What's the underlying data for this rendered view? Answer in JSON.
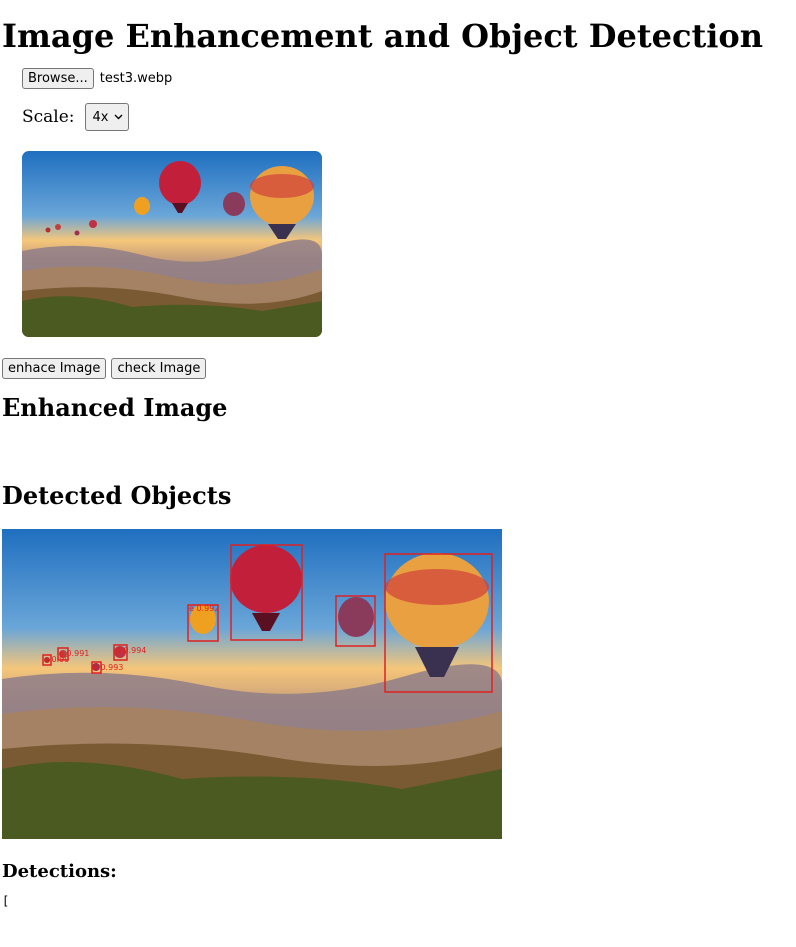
{
  "page": {
    "title": "Image Enhancement and Object Detection"
  },
  "upload": {
    "browse_label": "Browse...",
    "filename": "test3.webp"
  },
  "scale": {
    "label": "Scale:",
    "selected": "4x"
  },
  "actions": {
    "enhance_label": "enhace Image",
    "check_label": "check Image"
  },
  "sections": {
    "enhanced_heading": "Enhanced Image",
    "detected_heading": "Detected Objects",
    "detections_heading": "Detections:"
  },
  "detections_output": "[",
  "detections": [
    {
      "label": "e 0.991"
    },
    {
      "label": "e 0.994"
    },
    {
      "label": "e 0.993"
    },
    {
      "label": "e 0.99"
    },
    {
      "label": "e 0.992"
    }
  ],
  "colors": {
    "box": "#e02020",
    "sky_top": "#1f6fc0",
    "sky_glow": "#f5c67a"
  }
}
